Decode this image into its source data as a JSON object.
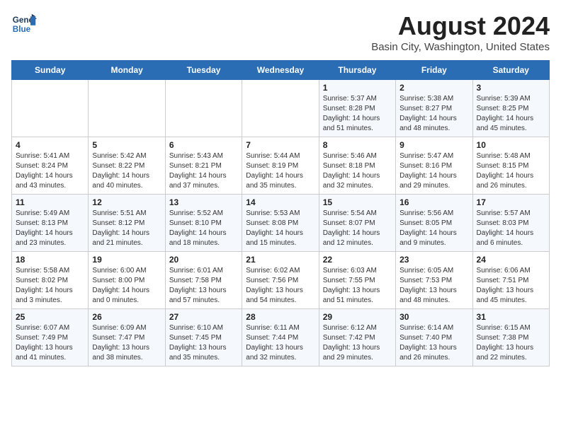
{
  "header": {
    "logo_line1": "General",
    "logo_line2": "Blue",
    "main_title": "August 2024",
    "sub_title": "Basin City, Washington, United States"
  },
  "days_of_week": [
    "Sunday",
    "Monday",
    "Tuesday",
    "Wednesday",
    "Thursday",
    "Friday",
    "Saturday"
  ],
  "weeks": [
    [
      {
        "num": "",
        "info": ""
      },
      {
        "num": "",
        "info": ""
      },
      {
        "num": "",
        "info": ""
      },
      {
        "num": "",
        "info": ""
      },
      {
        "num": "1",
        "info": "Sunrise: 5:37 AM\nSunset: 8:28 PM\nDaylight: 14 hours\nand 51 minutes."
      },
      {
        "num": "2",
        "info": "Sunrise: 5:38 AM\nSunset: 8:27 PM\nDaylight: 14 hours\nand 48 minutes."
      },
      {
        "num": "3",
        "info": "Sunrise: 5:39 AM\nSunset: 8:25 PM\nDaylight: 14 hours\nand 45 minutes."
      }
    ],
    [
      {
        "num": "4",
        "info": "Sunrise: 5:41 AM\nSunset: 8:24 PM\nDaylight: 14 hours\nand 43 minutes."
      },
      {
        "num": "5",
        "info": "Sunrise: 5:42 AM\nSunset: 8:22 PM\nDaylight: 14 hours\nand 40 minutes."
      },
      {
        "num": "6",
        "info": "Sunrise: 5:43 AM\nSunset: 8:21 PM\nDaylight: 14 hours\nand 37 minutes."
      },
      {
        "num": "7",
        "info": "Sunrise: 5:44 AM\nSunset: 8:19 PM\nDaylight: 14 hours\nand 35 minutes."
      },
      {
        "num": "8",
        "info": "Sunrise: 5:46 AM\nSunset: 8:18 PM\nDaylight: 14 hours\nand 32 minutes."
      },
      {
        "num": "9",
        "info": "Sunrise: 5:47 AM\nSunset: 8:16 PM\nDaylight: 14 hours\nand 29 minutes."
      },
      {
        "num": "10",
        "info": "Sunrise: 5:48 AM\nSunset: 8:15 PM\nDaylight: 14 hours\nand 26 minutes."
      }
    ],
    [
      {
        "num": "11",
        "info": "Sunrise: 5:49 AM\nSunset: 8:13 PM\nDaylight: 14 hours\nand 23 minutes."
      },
      {
        "num": "12",
        "info": "Sunrise: 5:51 AM\nSunset: 8:12 PM\nDaylight: 14 hours\nand 21 minutes."
      },
      {
        "num": "13",
        "info": "Sunrise: 5:52 AM\nSunset: 8:10 PM\nDaylight: 14 hours\nand 18 minutes."
      },
      {
        "num": "14",
        "info": "Sunrise: 5:53 AM\nSunset: 8:08 PM\nDaylight: 14 hours\nand 15 minutes."
      },
      {
        "num": "15",
        "info": "Sunrise: 5:54 AM\nSunset: 8:07 PM\nDaylight: 14 hours\nand 12 minutes."
      },
      {
        "num": "16",
        "info": "Sunrise: 5:56 AM\nSunset: 8:05 PM\nDaylight: 14 hours\nand 9 minutes."
      },
      {
        "num": "17",
        "info": "Sunrise: 5:57 AM\nSunset: 8:03 PM\nDaylight: 14 hours\nand 6 minutes."
      }
    ],
    [
      {
        "num": "18",
        "info": "Sunrise: 5:58 AM\nSunset: 8:02 PM\nDaylight: 14 hours\nand 3 minutes."
      },
      {
        "num": "19",
        "info": "Sunrise: 6:00 AM\nSunset: 8:00 PM\nDaylight: 14 hours\nand 0 minutes."
      },
      {
        "num": "20",
        "info": "Sunrise: 6:01 AM\nSunset: 7:58 PM\nDaylight: 13 hours\nand 57 minutes."
      },
      {
        "num": "21",
        "info": "Sunrise: 6:02 AM\nSunset: 7:56 PM\nDaylight: 13 hours\nand 54 minutes."
      },
      {
        "num": "22",
        "info": "Sunrise: 6:03 AM\nSunset: 7:55 PM\nDaylight: 13 hours\nand 51 minutes."
      },
      {
        "num": "23",
        "info": "Sunrise: 6:05 AM\nSunset: 7:53 PM\nDaylight: 13 hours\nand 48 minutes."
      },
      {
        "num": "24",
        "info": "Sunrise: 6:06 AM\nSunset: 7:51 PM\nDaylight: 13 hours\nand 45 minutes."
      }
    ],
    [
      {
        "num": "25",
        "info": "Sunrise: 6:07 AM\nSunset: 7:49 PM\nDaylight: 13 hours\nand 41 minutes."
      },
      {
        "num": "26",
        "info": "Sunrise: 6:09 AM\nSunset: 7:47 PM\nDaylight: 13 hours\nand 38 minutes."
      },
      {
        "num": "27",
        "info": "Sunrise: 6:10 AM\nSunset: 7:45 PM\nDaylight: 13 hours\nand 35 minutes."
      },
      {
        "num": "28",
        "info": "Sunrise: 6:11 AM\nSunset: 7:44 PM\nDaylight: 13 hours\nand 32 minutes."
      },
      {
        "num": "29",
        "info": "Sunrise: 6:12 AM\nSunset: 7:42 PM\nDaylight: 13 hours\nand 29 minutes."
      },
      {
        "num": "30",
        "info": "Sunrise: 6:14 AM\nSunset: 7:40 PM\nDaylight: 13 hours\nand 26 minutes."
      },
      {
        "num": "31",
        "info": "Sunrise: 6:15 AM\nSunset: 7:38 PM\nDaylight: 13 hours\nand 22 minutes."
      }
    ]
  ]
}
